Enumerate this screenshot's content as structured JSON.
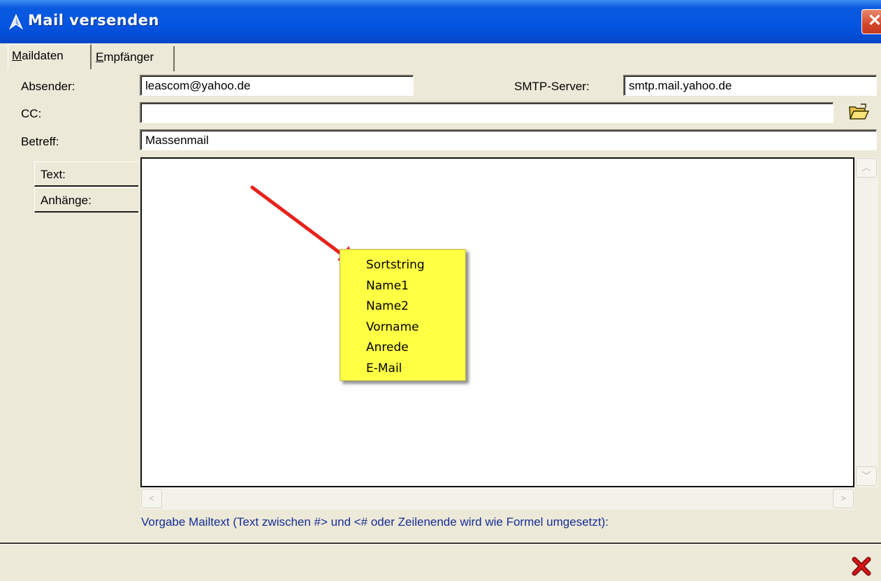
{
  "window": {
    "title": "Mail versenden",
    "close_glyph": "✕"
  },
  "tabs": [
    {
      "label_underlined": "M",
      "label_rest": "aildaten"
    },
    {
      "label_underlined": "E",
      "label_rest": "mpfänger"
    }
  ],
  "form": {
    "absender_label": "Absender:",
    "absender_value": "leascom@yahoo.de",
    "smtp_label": "SMTP-Server:",
    "smtp_value": "smtp.mail.yahoo.de",
    "cc_label": "CC:",
    "cc_value": "",
    "betreff_label": "Betreff:",
    "betreff_value": "Massenmail"
  },
  "side_tabs": [
    "Text:",
    "Anhänge:"
  ],
  "popup_menu": [
    "Sortstring",
    "Name1",
    "Name2",
    "Vorname",
    "Anrede",
    "E-Mail"
  ],
  "hint": "Vorgabe Mailtext (Text zwischen #> und <# oder Zeilenende wird wie Formel umgesetzt):",
  "icons": {
    "title": "app-icon",
    "folder": "open-folder-icon",
    "cancel": "red-x-icon",
    "arrow": "red-arrow-annotation"
  },
  "colors": {
    "titlebar": "#0454e2",
    "popup": "#ffff44",
    "hint_text": "#172d96",
    "arrow": "#e8221c",
    "cancel": "#cc1111"
  }
}
